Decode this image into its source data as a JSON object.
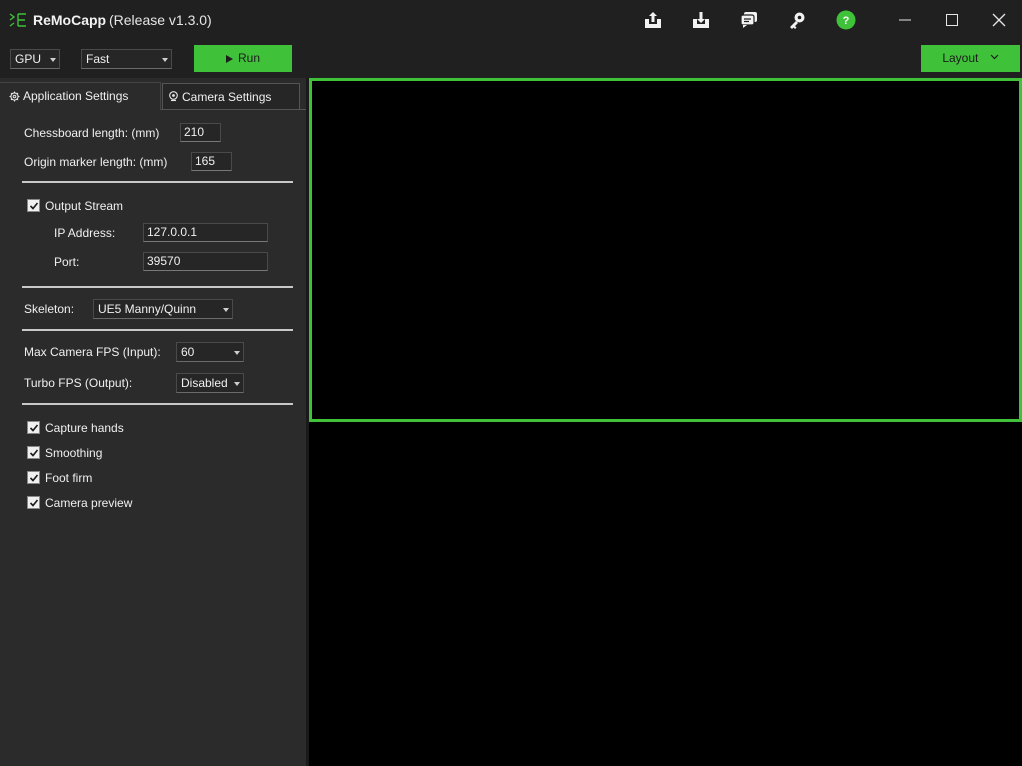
{
  "app": {
    "name": "ReMoCapp",
    "version": "(Release v1.3.0)",
    "brand_color": "#3fc13a"
  },
  "titlebar_icons": [
    "upload-icon",
    "download-icon",
    "chat-icon",
    "key-icon",
    "help-icon",
    "minimize-icon",
    "maximize-icon",
    "close-icon"
  ],
  "toolbar": {
    "device": "GPU",
    "mode": "Fast",
    "run_label": "Run",
    "layout_label": "Layout"
  },
  "tabs": {
    "app_settings": "Application Settings",
    "camera_settings": "Camera Settings"
  },
  "settings": {
    "chessboard_label": "Chessboard length: (mm)",
    "chessboard_value": "210",
    "origin_label": "Origin marker length: (mm)",
    "origin_value": "165",
    "output_stream_label": "Output Stream",
    "output_stream_checked": true,
    "ip_label": "IP Address:",
    "ip_value": "127.0.0.1",
    "port_label": "Port:",
    "port_value": "39570",
    "skeleton_label": "Skeleton:",
    "skeleton_value": "UE5 Manny/Quinn",
    "max_fps_label": "Max Camera FPS (Input):",
    "max_fps_value": "60",
    "turbo_label": "Turbo FPS (Output):",
    "turbo_value": "Disabled",
    "capture_hands": "Capture hands",
    "smoothing": "Smoothing",
    "foot_firm": "Foot firm",
    "camera_preview": "Camera preview"
  }
}
